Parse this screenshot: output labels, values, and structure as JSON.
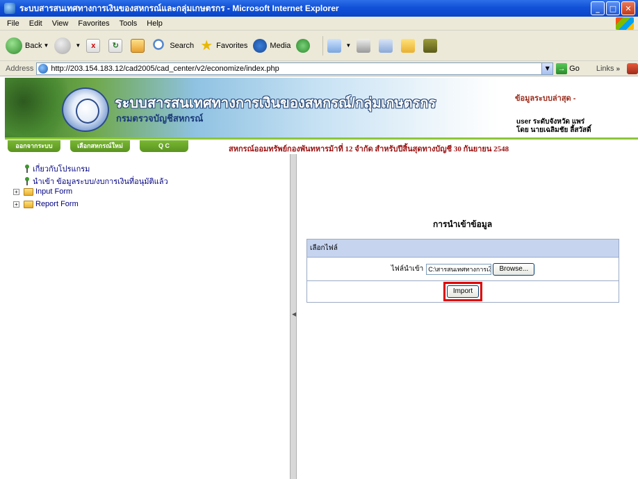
{
  "window": {
    "title": "ระบบสารสนเทศทางการเงินของสหกรณ์และกลุ่มเกษตรกร - Microsoft Internet Explorer"
  },
  "menu": {
    "items": [
      "File",
      "Edit",
      "View",
      "Favorites",
      "Tools",
      "Help"
    ]
  },
  "toolbar": {
    "back": "Back",
    "search": "Search",
    "favorites": "Favorites",
    "media": "Media"
  },
  "address": {
    "label": "Address",
    "url": "http://203.154.183.12/cad2005/cad_center/v2/economize/index.php",
    "go": "Go",
    "links": "Links"
  },
  "banner": {
    "title": "ระบบสารสนเทศทางการเงินของสหกรณ์/กลุ่มเกษตรกร",
    "subtitle": "กรมตรวจบัญชีสหกรณ์",
    "data_label": "ข้อมูลระบบล่าสุด -",
    "user_line1": "user ระดับจังหวัด แพร่",
    "user_line2": "โดย นายเฉลิมชัย ลี้สวัสดิ์"
  },
  "nav": {
    "tabs": [
      "ออกจากระบบ",
      "เลือกสหกรณ์ใหม่",
      "Q C"
    ],
    "notice": "สหกรณ์ออมทรัพย์กองพันทหารม้าที่ 12 จำกัด สำหรับปีสิ้นสุดทางบัญชี 30 กันยายน 2548"
  },
  "tree": {
    "items": [
      {
        "label": "เกี่ยวกับโปรแกรม"
      },
      {
        "label": "นำเข้า ข้อมูลระบบ/งบการเงินที่อนุมัติแล้ว"
      },
      {
        "label": "Input Form"
      },
      {
        "label": "Report Form"
      }
    ]
  },
  "form": {
    "title": "การนำเข้าข้อมูล",
    "section_header": "เลือกไฟล์",
    "file_label": "ไฟล์นำเข้า",
    "file_value": "C:\\สารสนเทศทางการเงิน\\",
    "browse": "Browse...",
    "import": "Import"
  },
  "colors": {
    "titlebar": "#1151d8",
    "nav_green": "#7ab832",
    "notice_red": "#9a1010",
    "highlight_red": "#e00000",
    "form_header": "#c6d4f0"
  }
}
